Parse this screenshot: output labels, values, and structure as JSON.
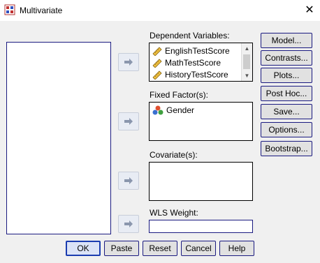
{
  "window": {
    "title": "Multivariate",
    "close_glyph": "✕"
  },
  "labels": {
    "dependent": "Dependent Variables:",
    "fixed": "Fixed Factor(s):",
    "covariate": "Covariate(s):",
    "wls": "WLS Weight:"
  },
  "dependent_items": [
    "EnglishTestScore",
    "MathTestScore",
    "HistoryTestScore"
  ],
  "fixed_items": [
    "Gender"
  ],
  "side_buttons": [
    "Model...",
    "Contrasts...",
    "Plots...",
    "Post Hoc...",
    "Save...",
    "Options...",
    "Bootstrap..."
  ],
  "bottom_buttons": [
    "OK",
    "Paste",
    "Reset",
    "Cancel",
    "Help"
  ],
  "wls_value": "",
  "icons": {
    "app": "multivariate-app-icon",
    "arrow": "right-arrow-icon",
    "scale": "ruler-scale-icon",
    "nominal": "nominal-circles-icon"
  },
  "colors": {
    "accent": "#1a1a80",
    "background": "#f0f0f0"
  }
}
